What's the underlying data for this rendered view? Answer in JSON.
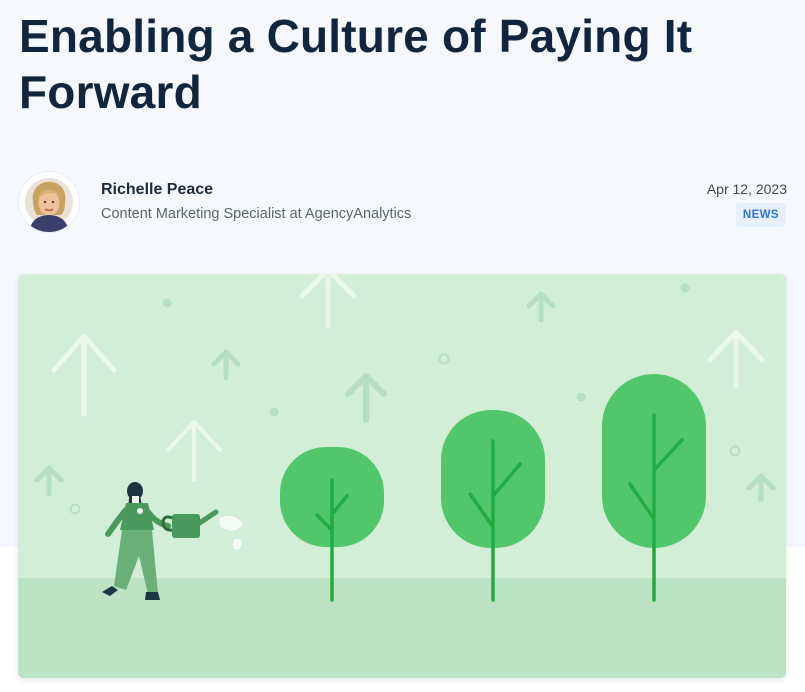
{
  "article": {
    "title": "Enabling a Culture of Paying It Forward",
    "date": "Apr 12, 2023",
    "category": "NEWS"
  },
  "author": {
    "name": "Richelle Peace",
    "role": "Content Marketing Specialist at AgencyAnalytics"
  },
  "hero": {
    "icons": [
      "up-arrow-icon",
      "watering-can-icon",
      "tree-icon",
      "person-icon"
    ],
    "colors": {
      "background": "#d2eed7",
      "ground": "#bce3c3",
      "tree_canopy": "#52c66b",
      "tree_trunk": "#22ab42",
      "person": "#4a9a60"
    }
  },
  "colors": {
    "title": "#11263c",
    "badge_text": "#2b74e0",
    "badge_bg": "#e8f0fb"
  }
}
